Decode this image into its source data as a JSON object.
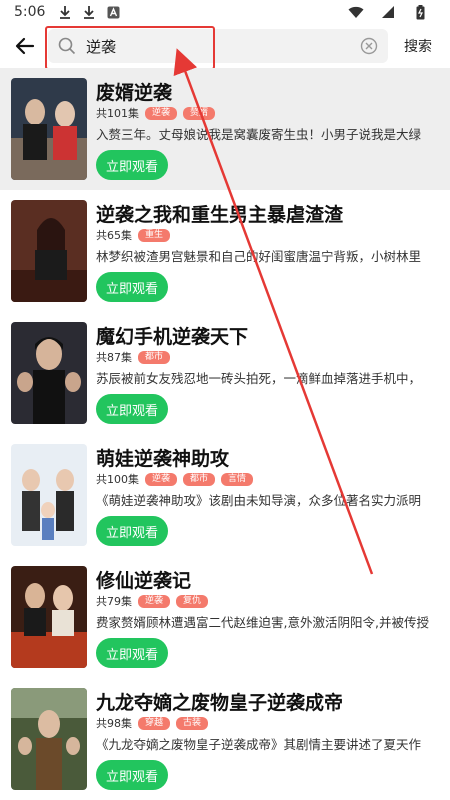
{
  "status_bar": {
    "time": "5:06"
  },
  "search": {
    "query": "逆袭",
    "button_label": "搜索"
  },
  "colors": {
    "accent_green": "#22c55e",
    "tag_red": "#f47a6c",
    "highlight_red": "#e53935"
  },
  "results": [
    {
      "title": "废婿逆袭",
      "episodes": "共101集",
      "tags": [
        "逆袭",
        "赘婿"
      ],
      "desc": "入赘三年。丈母娘说我是窝囊废寄生虫！小男子说我是大绿",
      "watch_label": "立即观看"
    },
    {
      "title": "逆袭之我和重生男主暴虐渣渣",
      "episodes": "共65集",
      "tags": [
        "重生"
      ],
      "desc": "林梦织被渣男宫魅景和自己的好闺蜜唐温宁背叛，小树林里",
      "watch_label": "立即观看"
    },
    {
      "title": "魔幻手机逆袭天下",
      "episodes": "共87集",
      "tags": [
        "都市"
      ],
      "desc": "苏辰被前女友残忍地一砖头拍死，一滴鲜血掉落进手机中，",
      "watch_label": "立即观看"
    },
    {
      "title": "萌娃逆袭神助攻",
      "episodes": "共100集",
      "tags": [
        "逆袭",
        "都市",
        "言情"
      ],
      "desc": "《萌娃逆袭神助攻》该剧由未知导演，众多位著名实力派明",
      "watch_label": "立即观看"
    },
    {
      "title": "修仙逆袭记",
      "episodes": "共79集",
      "tags": [
        "逆袭",
        "复仇"
      ],
      "desc": "费家赘婿顾林遭遇富二代赵维迫害,意外激活阴阳令,并被传授",
      "watch_label": "立即观看"
    },
    {
      "title": "九龙夺嫡之废物皇子逆袭成帝",
      "episodes": "共98集",
      "tags": [
        "穿越",
        "古装"
      ],
      "desc": "《九龙夺嫡之废物皇子逆袭成帝》其剧情主要讲述了夏天作",
      "watch_label": "立即观看"
    }
  ]
}
